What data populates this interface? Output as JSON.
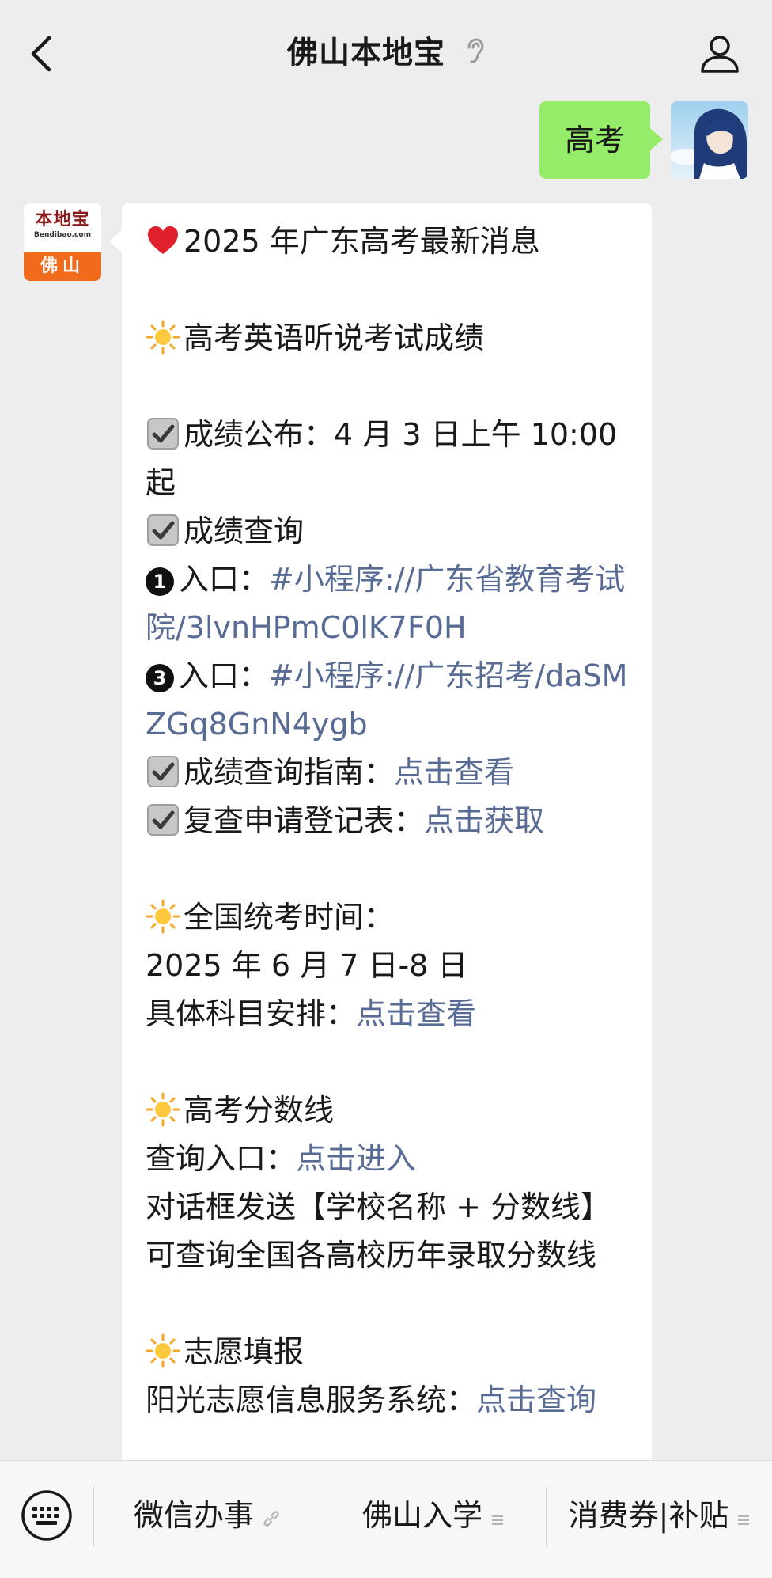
{
  "header": {
    "title": "佛山本地宝",
    "back_icon": "chevron-left-icon",
    "ear_icon": "ear-icon",
    "profile_icon": "person-icon"
  },
  "user_message": {
    "text": "高考"
  },
  "bot_avatar": {
    "logo_cn": "本地宝",
    "logo_en": "Bendibao.com",
    "city": "佛山"
  },
  "message": {
    "title": "2025 年广东高考最新消息",
    "s1_title": "高考英语听说考试成绩",
    "s1_release": "成绩公布：4 月 3 日上午 10:00 起",
    "s1_query": "成绩查询",
    "s1_entry1_label": "入口：",
    "s1_entry1_link": "#小程序://广东省教育考试院/3lvnHPmC0lK7F0H",
    "s1_entry3_label": "入口：",
    "s1_entry3_link": "#小程序://广东招考/daSMZGq8GnN4ygb",
    "s1_guide_label": "成绩查询指南：",
    "s1_guide_link": "点击查看",
    "s1_review_label": "复查申请登记表：",
    "s1_review_link": "点击获取",
    "s2_title": "全国统考时间：",
    "s2_date": "2025 年 6 月 7 日-8 日",
    "s2_subject_label": "具体科目安排：",
    "s2_subject_link": "点击查看",
    "s3_title": "高考分数线",
    "s3_query_label": "查询入口：",
    "s3_query_link": "点击进入",
    "s3_tip1": "对话框发送【学校名称 + 分数线】",
    "s3_tip2": "可查询全国各高校历年录取分数线",
    "s4_title": "志愿填报",
    "s4_system_label": "阳光志愿信息服务系统：",
    "s4_system_link": "点击查询",
    "badge1": "1",
    "badge3": "3"
  },
  "bottom_menu": {
    "keyboard_icon": "keyboard-icon",
    "item1": "微信办事",
    "item2": "佛山入学",
    "item3": "消费券|补贴"
  },
  "colors": {
    "background": "#ededed",
    "user_bubble": "#95ec69",
    "link": "#576b95",
    "logo_orange": "#f26b1d"
  }
}
